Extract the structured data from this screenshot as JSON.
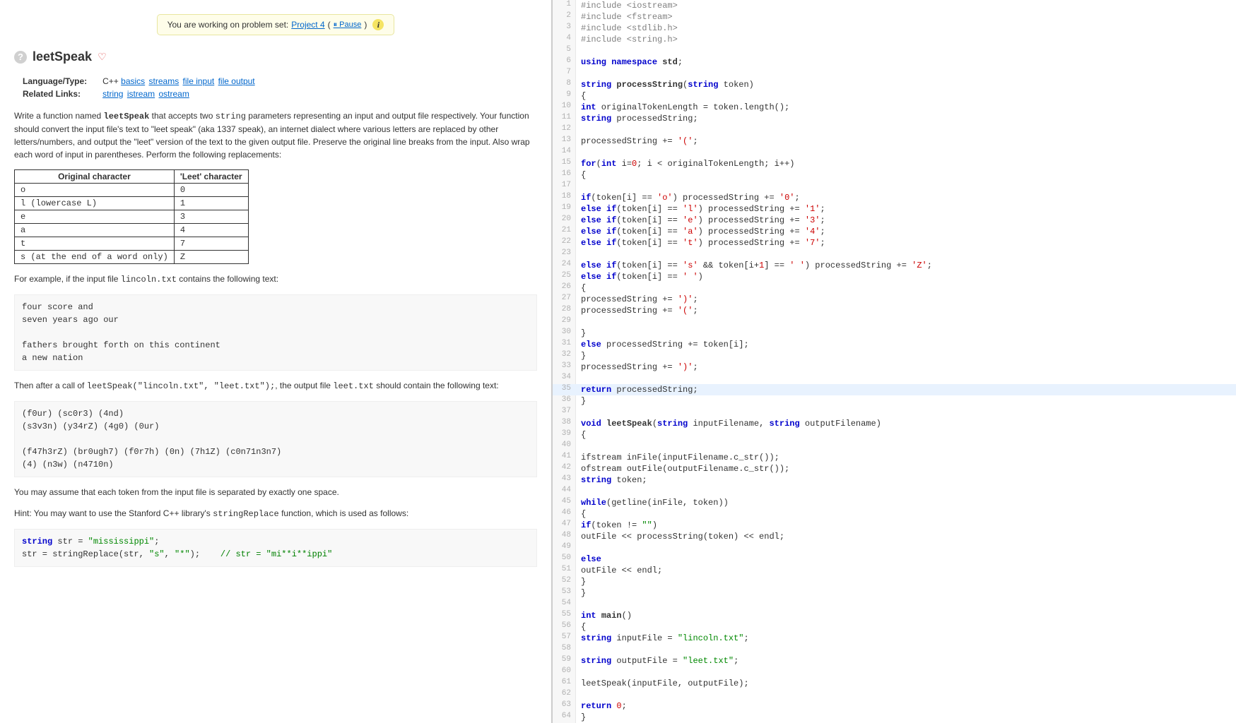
{
  "banner": {
    "prefix": "You are working on problem set: ",
    "link": "Project 4",
    "pause": "⏸ Pause"
  },
  "title": "leetSpeak",
  "meta": {
    "lang_label": "Language/Type:",
    "lang_value": "C++",
    "lang_links": [
      "basics",
      "streams",
      "file input",
      "file output"
    ],
    "related_label": "Related Links:",
    "related_links": [
      "string",
      "istream",
      "ostream"
    ]
  },
  "paragraphs": {
    "p1a": "Write a function named ",
    "p1code": "leetSpeak",
    "p1b": " that accepts two ",
    "p1code2": "string",
    "p1c": " parameters representing an input and output file respectively. Your function should convert the input file's text to \"leet speak\" (aka 1337 speak), an internet dialect where various letters are replaced by other letters/numbers, and output the \"leet\" version of the text to the given output file. Preserve the original line breaks from the input. Also wrap each word of input in parentheses. Perform the following replacements:"
  },
  "table": {
    "h1": "Original character",
    "h2": "'Leet' character",
    "rows": [
      [
        "o",
        "0"
      ],
      [
        "l (lowercase L)",
        "1"
      ],
      [
        "e",
        "3"
      ],
      [
        "a",
        "4"
      ],
      [
        "t",
        "7"
      ],
      [
        "s (at the end of a word only)",
        "Z"
      ]
    ]
  },
  "para2a": "For example, if the input file ",
  "para2code": "lincoln.txt",
  "para2b": " contains the following text:",
  "pre1": "four score and\nseven years ago our\n\nfathers brought forth on this continent\na new nation",
  "para3a": "Then after a call of ",
  "para3code": "leetSpeak(\"lincoln.txt\", \"leet.txt\");",
  "para3b": ", the output file ",
  "para3code2": "leet.txt",
  "para3c": " should contain the following text:",
  "pre2": "(f0ur) (sc0r3) (4nd)\n(s3v3n) (y34rZ) (4g0) (0ur)\n\n(f47h3rZ) (br0ugh7) (f0r7h) (0n) (7h1Z) (c0n71n3n7)\n(4) (n3w) (n4710n)",
  "para4": "You may assume that each token from the input file is separated by exactly one space.",
  "para5a": "Hint: You may want to use the Stanford C++ library's ",
  "para5code": "stringReplace",
  "para5b": " function, which is used as follows:",
  "pre3": {
    "l1k": "string",
    "l1a": " str = ",
    "l1s": "\"mississippi\"",
    "l1e": ";",
    "l2a": "str = stringReplace(str, ",
    "l2s1": "\"s\"",
    "l2m": ", ",
    "l2s2": "\"*\"",
    "l2e": ");    ",
    "l2c": "// str = \"mi**i**ippi\""
  },
  "code": [
    {
      "n": 1,
      "seg": [
        [
          "pp",
          "#include <iostream>"
        ]
      ]
    },
    {
      "n": 2,
      "seg": [
        [
          "pp",
          "#include <fstream>"
        ]
      ]
    },
    {
      "n": 3,
      "seg": [
        [
          "pp",
          "#include <stdlib.h>"
        ]
      ]
    },
    {
      "n": 4,
      "seg": [
        [
          "pp",
          "#include <string.h>"
        ]
      ]
    },
    {
      "n": 5,
      "seg": []
    },
    {
      "n": 6,
      "seg": [
        [
          "kw",
          "using namespace "
        ],
        [
          "fn",
          "std"
        ],
        [
          "",
          ";"
        ]
      ]
    },
    {
      "n": 7,
      "seg": []
    },
    {
      "n": 8,
      "seg": [
        [
          "kw",
          "string "
        ],
        [
          "fn",
          "processString"
        ],
        [
          "",
          "("
        ],
        [
          "kw",
          "string"
        ],
        [
          "",
          " token)"
        ]
      ]
    },
    {
      "n": 9,
      "seg": [
        [
          "",
          "{"
        ]
      ]
    },
    {
      "n": 10,
      "seg": [
        [
          "kw",
          "int"
        ],
        [
          "",
          " originalTokenLength = token.length();"
        ]
      ]
    },
    {
      "n": 11,
      "seg": [
        [
          "kw",
          "string"
        ],
        [
          "",
          " processedString;"
        ]
      ]
    },
    {
      "n": 12,
      "seg": []
    },
    {
      "n": 13,
      "seg": [
        [
          "",
          "processedString += "
        ],
        [
          "str",
          "'('"
        ],
        [
          "",
          ";"
        ]
      ]
    },
    {
      "n": 14,
      "seg": []
    },
    {
      "n": 15,
      "seg": [
        [
          "kw",
          "for"
        ],
        [
          "",
          "("
        ],
        [
          "kw",
          "int"
        ],
        [
          "",
          " i="
        ],
        [
          "str",
          "0"
        ],
        [
          "",
          "; i < originalTokenLength; i++)"
        ]
      ]
    },
    {
      "n": 16,
      "seg": [
        [
          "",
          "{"
        ]
      ]
    },
    {
      "n": 17,
      "seg": []
    },
    {
      "n": 18,
      "seg": [
        [
          "kw",
          "if"
        ],
        [
          "",
          "(token[i] == "
        ],
        [
          "str",
          "'o'"
        ],
        [
          "",
          ") processedString += "
        ],
        [
          "str",
          "'0'"
        ],
        [
          "",
          ";"
        ]
      ]
    },
    {
      "n": 19,
      "seg": [
        [
          "kw",
          "else if"
        ],
        [
          "",
          "(token[i] == "
        ],
        [
          "str",
          "'l'"
        ],
        [
          "",
          ") processedString += "
        ],
        [
          "str",
          "'1'"
        ],
        [
          "",
          ";"
        ]
      ]
    },
    {
      "n": 20,
      "seg": [
        [
          "kw",
          "else if"
        ],
        [
          "",
          "(token[i] == "
        ],
        [
          "str",
          "'e'"
        ],
        [
          "",
          ") processedString += "
        ],
        [
          "str",
          "'3'"
        ],
        [
          "",
          ";"
        ]
      ]
    },
    {
      "n": 21,
      "seg": [
        [
          "kw",
          "else if"
        ],
        [
          "",
          "(token[i] == "
        ],
        [
          "str",
          "'a'"
        ],
        [
          "",
          ") processedString += "
        ],
        [
          "str",
          "'4'"
        ],
        [
          "",
          ";"
        ]
      ]
    },
    {
      "n": 22,
      "seg": [
        [
          "kw",
          "else if"
        ],
        [
          "",
          "(token[i] == "
        ],
        [
          "str",
          "'t'"
        ],
        [
          "",
          ") processedString += "
        ],
        [
          "str",
          "'7'"
        ],
        [
          "",
          ";"
        ]
      ]
    },
    {
      "n": 23,
      "seg": []
    },
    {
      "n": 24,
      "seg": [
        [
          "kw",
          "else if"
        ],
        [
          "",
          "(token[i] == "
        ],
        [
          "str",
          "'s'"
        ],
        [
          "",
          " && token[i+"
        ],
        [
          "str",
          "1"
        ],
        [
          "",
          "] == "
        ],
        [
          "str",
          "' '"
        ],
        [
          "",
          ") processedString += "
        ],
        [
          "str",
          "'Z'"
        ],
        [
          "",
          ";"
        ]
      ]
    },
    {
      "n": 25,
      "seg": [
        [
          "kw",
          "else if"
        ],
        [
          "",
          "(token[i] == "
        ],
        [
          "str",
          "' '"
        ],
        [
          "",
          ")"
        ]
      ]
    },
    {
      "n": 26,
      "seg": [
        [
          "",
          "{"
        ]
      ]
    },
    {
      "n": 27,
      "seg": [
        [
          "",
          "processedString += "
        ],
        [
          "str",
          "')'"
        ],
        [
          "",
          ";"
        ]
      ]
    },
    {
      "n": 28,
      "seg": [
        [
          "",
          "processedString += "
        ],
        [
          "str",
          "'('"
        ],
        [
          "",
          ";"
        ]
      ]
    },
    {
      "n": 29,
      "seg": []
    },
    {
      "n": 30,
      "seg": [
        [
          "",
          "}"
        ]
      ]
    },
    {
      "n": 31,
      "seg": [
        [
          "kw",
          "else"
        ],
        [
          "",
          " processedString += token[i];"
        ]
      ]
    },
    {
      "n": 32,
      "seg": [
        [
          "",
          "}"
        ]
      ]
    },
    {
      "n": 33,
      "seg": [
        [
          "",
          "processedString += "
        ],
        [
          "str",
          "')'"
        ],
        [
          "",
          ";"
        ]
      ]
    },
    {
      "n": 34,
      "seg": []
    },
    {
      "n": 35,
      "hl": true,
      "seg": [
        [
          "kw",
          "return"
        ],
        [
          "",
          " processedString;"
        ]
      ]
    },
    {
      "n": 36,
      "seg": [
        [
          "",
          "}"
        ]
      ]
    },
    {
      "n": 37,
      "seg": []
    },
    {
      "n": 38,
      "seg": [
        [
          "kw",
          "void "
        ],
        [
          "fn",
          "leetSpeak"
        ],
        [
          "",
          "("
        ],
        [
          "kw",
          "string"
        ],
        [
          "",
          " inputFilename, "
        ],
        [
          "kw",
          "string"
        ],
        [
          "",
          " outputFilename)"
        ]
      ]
    },
    {
      "n": 39,
      "seg": [
        [
          "",
          "{"
        ]
      ]
    },
    {
      "n": 40,
      "seg": []
    },
    {
      "n": 41,
      "seg": [
        [
          "",
          "ifstream inFile(inputFilename.c_str());"
        ]
      ]
    },
    {
      "n": 42,
      "seg": [
        [
          "",
          "ofstream outFile(outputFilename.c_str());"
        ]
      ]
    },
    {
      "n": 43,
      "seg": [
        [
          "kw",
          "string"
        ],
        [
          "",
          " token;"
        ]
      ]
    },
    {
      "n": 44,
      "seg": []
    },
    {
      "n": 45,
      "seg": [
        [
          "kw",
          "while"
        ],
        [
          "",
          "(getline(inFile, token))"
        ]
      ]
    },
    {
      "n": 46,
      "seg": [
        [
          "",
          "{"
        ]
      ]
    },
    {
      "n": 47,
      "seg": [
        [
          "kw",
          "if"
        ],
        [
          "",
          "(token != "
        ],
        [
          "strgreen",
          "\"\""
        ],
        [
          "",
          ")"
        ]
      ]
    },
    {
      "n": 48,
      "seg": [
        [
          "",
          "outFile << processString(token) << endl;"
        ]
      ]
    },
    {
      "n": 49,
      "seg": []
    },
    {
      "n": 50,
      "seg": [
        [
          "kw",
          "else"
        ]
      ]
    },
    {
      "n": 51,
      "seg": [
        [
          "",
          "outFile << endl;"
        ]
      ]
    },
    {
      "n": 52,
      "seg": [
        [
          "",
          "}"
        ]
      ]
    },
    {
      "n": 53,
      "seg": [
        [
          "",
          "}"
        ]
      ]
    },
    {
      "n": 54,
      "seg": []
    },
    {
      "n": 55,
      "seg": [
        [
          "kw",
          "int "
        ],
        [
          "fn",
          "main"
        ],
        [
          "",
          "()"
        ]
      ]
    },
    {
      "n": 56,
      "seg": [
        [
          "",
          "{"
        ]
      ]
    },
    {
      "n": 57,
      "seg": [
        [
          "kw",
          "string"
        ],
        [
          "",
          " inputFile = "
        ],
        [
          "strgreen",
          "\"lincoln.txt\""
        ],
        [
          "",
          ";"
        ]
      ]
    },
    {
      "n": 58,
      "seg": []
    },
    {
      "n": 59,
      "seg": [
        [
          "kw",
          "string"
        ],
        [
          "",
          " outputFile = "
        ],
        [
          "strgreen",
          "\"leet.txt\""
        ],
        [
          "",
          ";"
        ]
      ]
    },
    {
      "n": 60,
      "seg": []
    },
    {
      "n": 61,
      "seg": [
        [
          "",
          "leetSpeak(inputFile, outputFile);"
        ]
      ]
    },
    {
      "n": 62,
      "seg": []
    },
    {
      "n": 63,
      "seg": [
        [
          "kw",
          "return "
        ],
        [
          "str",
          "0"
        ],
        [
          "",
          ";"
        ]
      ]
    },
    {
      "n": 64,
      "seg": [
        [
          "",
          "}"
        ]
      ]
    }
  ]
}
